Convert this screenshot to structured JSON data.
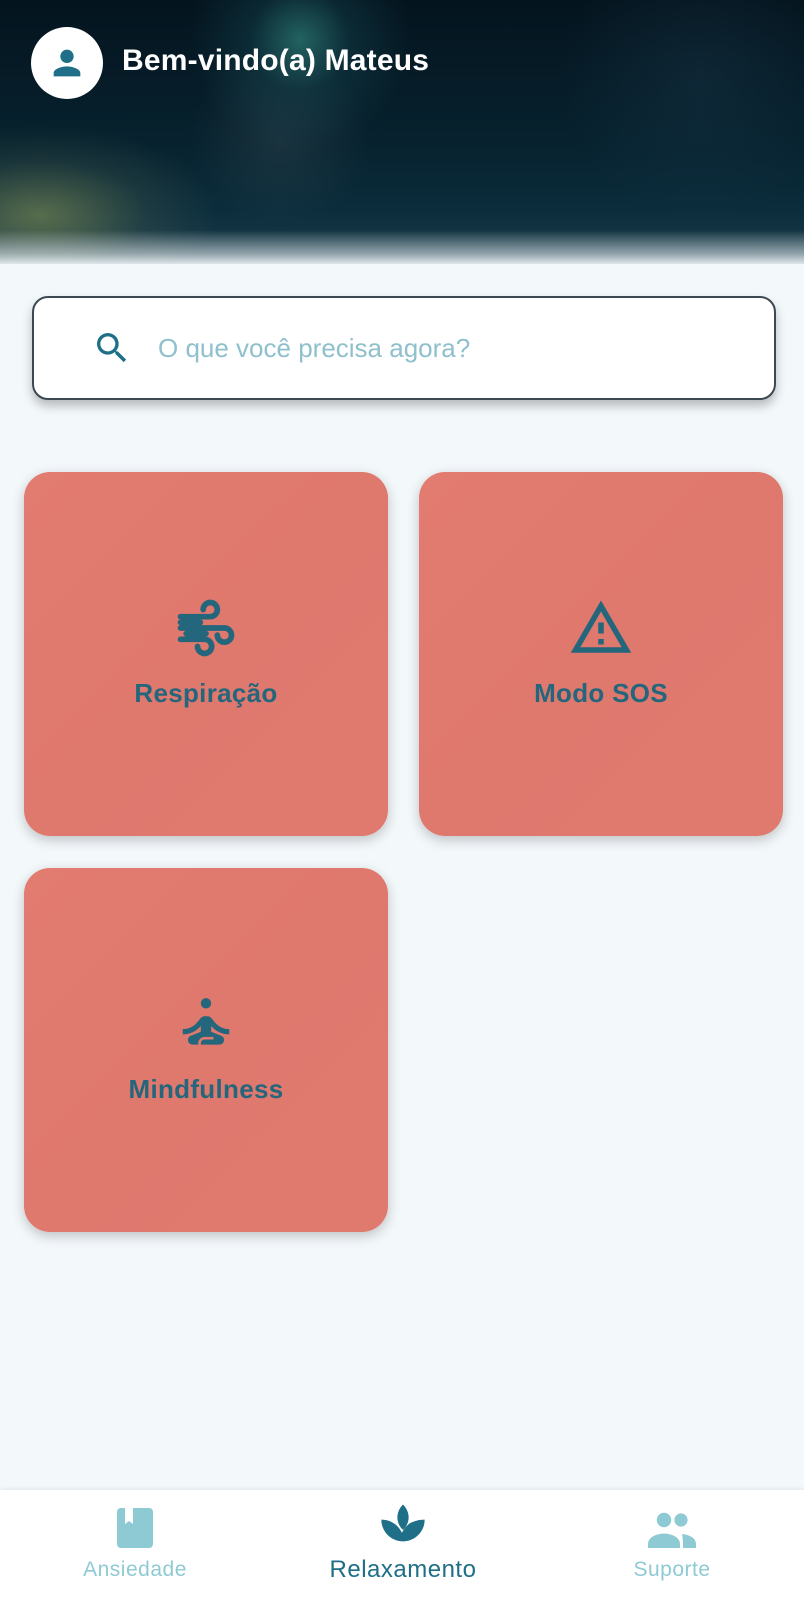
{
  "header": {
    "welcome": "Bem-vindo(a) Mateus",
    "avatar_icon": "person-icon"
  },
  "search": {
    "placeholder": "O que você precisa agora?",
    "value": "",
    "icon": "search-icon"
  },
  "cards": [
    {
      "label": "Respiração",
      "icon": "wind-icon"
    },
    {
      "label": "Modo SOS",
      "icon": "warning-icon"
    },
    {
      "label": "Mindfulness",
      "icon": "meditation-icon"
    }
  ],
  "nav": {
    "items": [
      {
        "label": "Ansiedade",
        "icon": "book-icon",
        "active": false
      },
      {
        "label": "Relaxamento",
        "icon": "spa-lotus-icon",
        "active": true
      },
      {
        "label": "Suporte",
        "icon": "group-icon",
        "active": false
      }
    ]
  },
  "colors": {
    "primary": "#1e6f87",
    "card": "#e07a6f",
    "inactive_nav": "#8ecad3",
    "background": "#f3f8fb",
    "header_dark": "#07222f"
  }
}
